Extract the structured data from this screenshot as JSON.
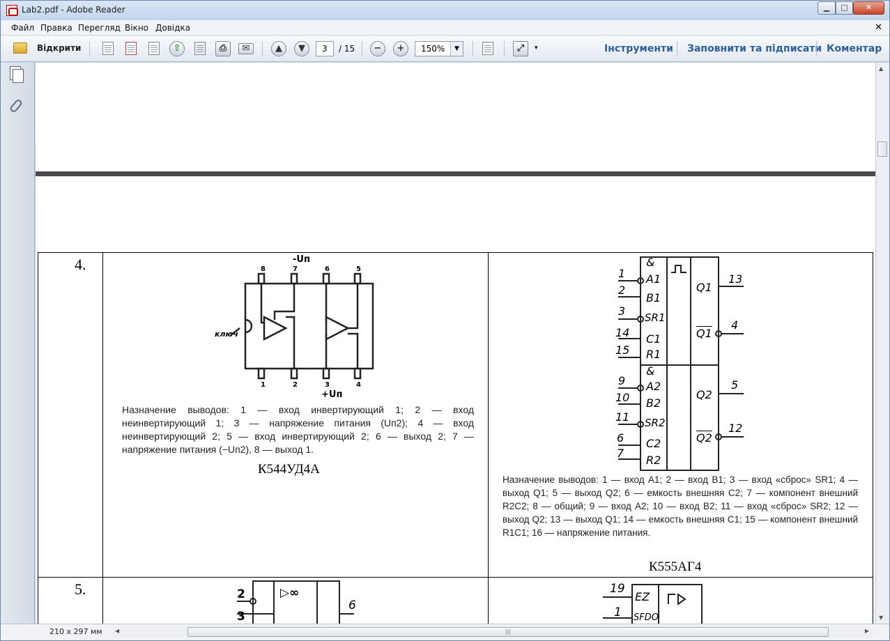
{
  "window": {
    "title": "Lab2.pdf - Adobe Reader"
  },
  "menu": [
    "Файл",
    "Правка",
    "Перегляд",
    "Вікно",
    "Довідка"
  ],
  "toolbar": {
    "open_label": "Відкрити",
    "page_current": "3",
    "page_total": "/ 15",
    "zoom": "150%",
    "tools_label": "Інструменти",
    "fill_sign_label": "Заповнити та підписати",
    "comment_label": "Коментар"
  },
  "status": {
    "page_size": "210 x 297 мм"
  },
  "document": {
    "rows": [
      {
        "number": "4.",
        "left": {
          "caption": "К544УД4А",
          "description": "Назначение выводов: 1 — вход инвертирующий 1; 2 — вход неинвертирующий 1; 3 — напряжение питания (Uп2); 4 — вход неинвертирующий 2; 5 — вход инвертирующий 2; 6 — выход 2; 7 — напряжение питания (−Uп2), 8 — выход 1.",
          "pins_top": [
            "8",
            "7",
            "6",
            "5"
          ],
          "pins_bottom": [
            "1",
            "2",
            "3",
            "4"
          ],
          "label_un_top": "-Uп",
          "label_un_bottom": "+Uп",
          "label_key": "ключ"
        },
        "right": {
          "caption": "К555АГ4",
          "description": "Назначение выводов: 1 — вход A1; 2 — вход B1; 3 — вход «сброс» SR1; 4 — выход Q1; 5 — выход Q2; 6 — емкость внешняя C2; 7 — компонент внешний R2C2; 8 — общий; 9 — вход A2; 10 — вход B2; 11 — вход «сброс» SR2; 12 — выход Q2; 13 — выход Q1; 14 — емкость внешняя C1; 15 — компонент внешний R1C1; 16 — напряжение питания.",
          "inputs_top": [
            [
              "1",
              "A1"
            ],
            [
              "2",
              "B1"
            ],
            [
              "3",
              "SR1"
            ],
            [
              "14",
              "C1"
            ],
            [
              "15",
              "R1"
            ]
          ],
          "inputs_bottom": [
            [
              "9",
              "A2"
            ],
            [
              "10",
              "B2"
            ],
            [
              "11",
              "SR2"
            ],
            [
              "6",
              "C2"
            ],
            [
              "7",
              "R2"
            ]
          ],
          "outputs": [
            [
              "13",
              "Q1"
            ],
            [
              "4",
              "Q1"
            ],
            [
              "5",
              "Q2"
            ],
            [
              "12",
              "Q2"
            ]
          ],
          "and_symbol": "&"
        }
      },
      {
        "number": "5.",
        "left": {
          "pins": [
            "2",
            "3",
            "6"
          ],
          "symbol": "▷∞"
        },
        "right": {
          "pins": [
            "19",
            "1"
          ],
          "labels": [
            "EZ",
            "SFDO"
          ]
        }
      }
    ]
  }
}
